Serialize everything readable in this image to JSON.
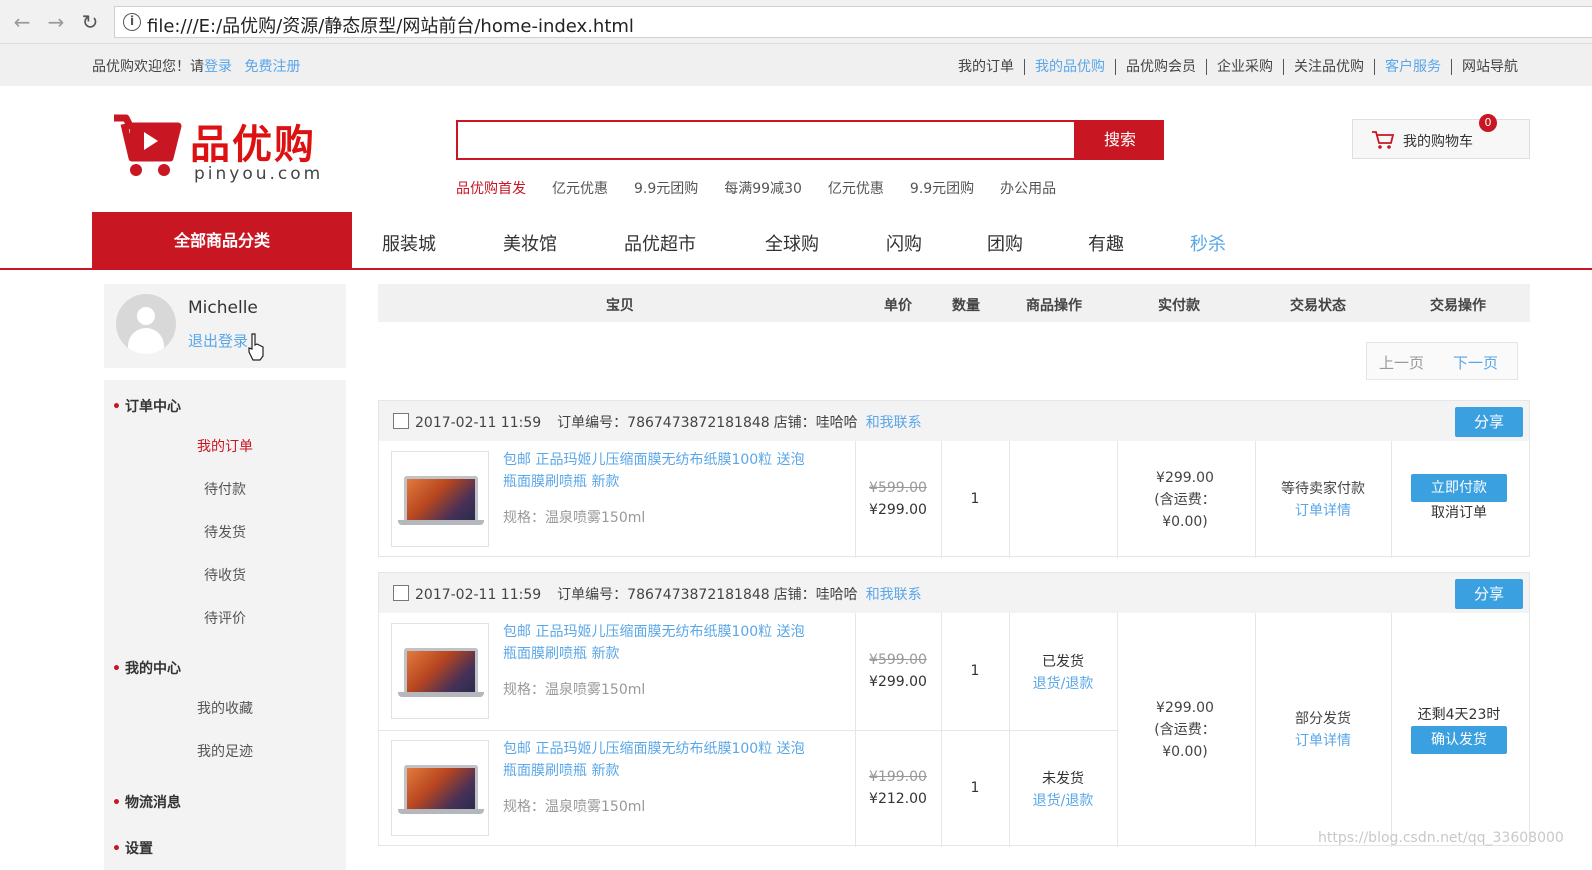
{
  "browser": {
    "back_icon": "arrow-left-icon",
    "forward_icon": "arrow-right-icon",
    "reload_icon": "reload-icon",
    "url": "file:///E:/品优购/资源/静态原型/网站前台/home-index.html"
  },
  "shortcut": {
    "welcome_prefix": "品优购欢迎您！",
    "please": "请",
    "login": "登录",
    "register": "免费注册",
    "links": [
      {
        "label": "我的订单",
        "active": false
      },
      {
        "label": "我的品优购",
        "active": true
      },
      {
        "label": "品优购会员",
        "active": false
      },
      {
        "label": "企业采购",
        "active": false
      },
      {
        "label": "关注品优购",
        "active": false
      },
      {
        "label": "客户服务",
        "active": true
      },
      {
        "label": "网站导航",
        "active": false
      }
    ]
  },
  "header": {
    "brand": "品优购",
    "domain": "pinyou.com",
    "search_placeholder": "",
    "search_button": "搜索",
    "hotwords": [
      "品优购首发",
      "亿元优惠",
      "9.9元团购",
      "每满99减30",
      "亿元优惠",
      "9.9元团购",
      "办公用品"
    ],
    "cart_label": "我的购物车",
    "cart_count": "0"
  },
  "nav": {
    "all_categories": "全部商品分类",
    "items": [
      {
        "label": "服装城",
        "active": false
      },
      {
        "label": "美妆馆",
        "active": false
      },
      {
        "label": "品优超市",
        "active": false
      },
      {
        "label": "全球购",
        "active": false
      },
      {
        "label": "闪购",
        "active": false
      },
      {
        "label": "团购",
        "active": false
      },
      {
        "label": "有趣",
        "active": false
      },
      {
        "label": "秒杀",
        "active": true
      }
    ]
  },
  "user": {
    "name": "Michelle",
    "logout": "退出登录"
  },
  "sidebar": {
    "sections": [
      {
        "title": "订单中心",
        "items": [
          "我的订单",
          "待付款",
          "待发货",
          "待收货",
          "待评价"
        ]
      },
      {
        "title": "我的中心",
        "items": [
          "我的收藏",
          "我的足迹"
        ]
      },
      {
        "title": "物流消息",
        "items": []
      },
      {
        "title": "设置",
        "items": []
      }
    ],
    "active_item": "我的订单"
  },
  "table": {
    "headers": [
      "宝贝",
      "单价",
      "数量",
      "商品操作",
      "实付款",
      "交易状态",
      "交易操作"
    ]
  },
  "pager": {
    "prev": "上一页",
    "next": "下一页"
  },
  "orders": [
    {
      "time": "2017-02-11 11:59",
      "order_no_label": "订单编号：",
      "order_no": "7867473872181848",
      "shop_label": "店铺：",
      "shop": "哇哈哈",
      "contact": "和我联系",
      "share": "分享",
      "items": [
        {
          "title": "包邮 正品玛姬儿压缩面膜无纺布纸膜100粒 送泡瓶面膜刷喷瓶 新款",
          "spec": "规格：温泉喷雾150ml",
          "old_price": "¥599.00",
          "price": "¥299.00",
          "qty": "1",
          "op_text": "",
          "op_link": ""
        }
      ],
      "paid": [
        "¥299.00",
        "(含运费：",
        "¥0.00)"
      ],
      "status_text": "等待卖家付款",
      "status_link": "订单详情",
      "action_note": "",
      "action_button": "立即付款",
      "action_text": "取消订单"
    },
    {
      "time": "2017-02-11 11:59",
      "order_no_label": "订单编号：",
      "order_no": "7867473872181848",
      "shop_label": "店铺：",
      "shop": "哇哈哈",
      "contact": "和我联系",
      "share": "分享",
      "items": [
        {
          "title": "包邮 正品玛姬儿压缩面膜无纺布纸膜100粒 送泡瓶面膜刷喷瓶 新款",
          "spec": "规格：温泉喷雾150ml",
          "old_price": "¥599.00",
          "price": "¥299.00",
          "qty": "1",
          "op_text": "已发货",
          "op_link": "退货/退款"
        },
        {
          "title": "包邮 正品玛姬儿压缩面膜无纺布纸膜100粒 送泡瓶面膜刷喷瓶 新款",
          "spec": "规格：温泉喷雾150ml",
          "old_price": "¥199.00",
          "price": "¥212.00",
          "qty": "1",
          "op_text": "未发货",
          "op_link": "退货/退款"
        }
      ],
      "paid": [
        "¥299.00",
        "(含运费：",
        "¥0.00)"
      ],
      "status_text": "部分发货",
      "status_link": "订单详情",
      "action_note": "还剩4天23时",
      "action_button": "确认发货",
      "action_text": ""
    }
  ],
  "watermark": "https://blog.csdn.net/qq_33608000"
}
